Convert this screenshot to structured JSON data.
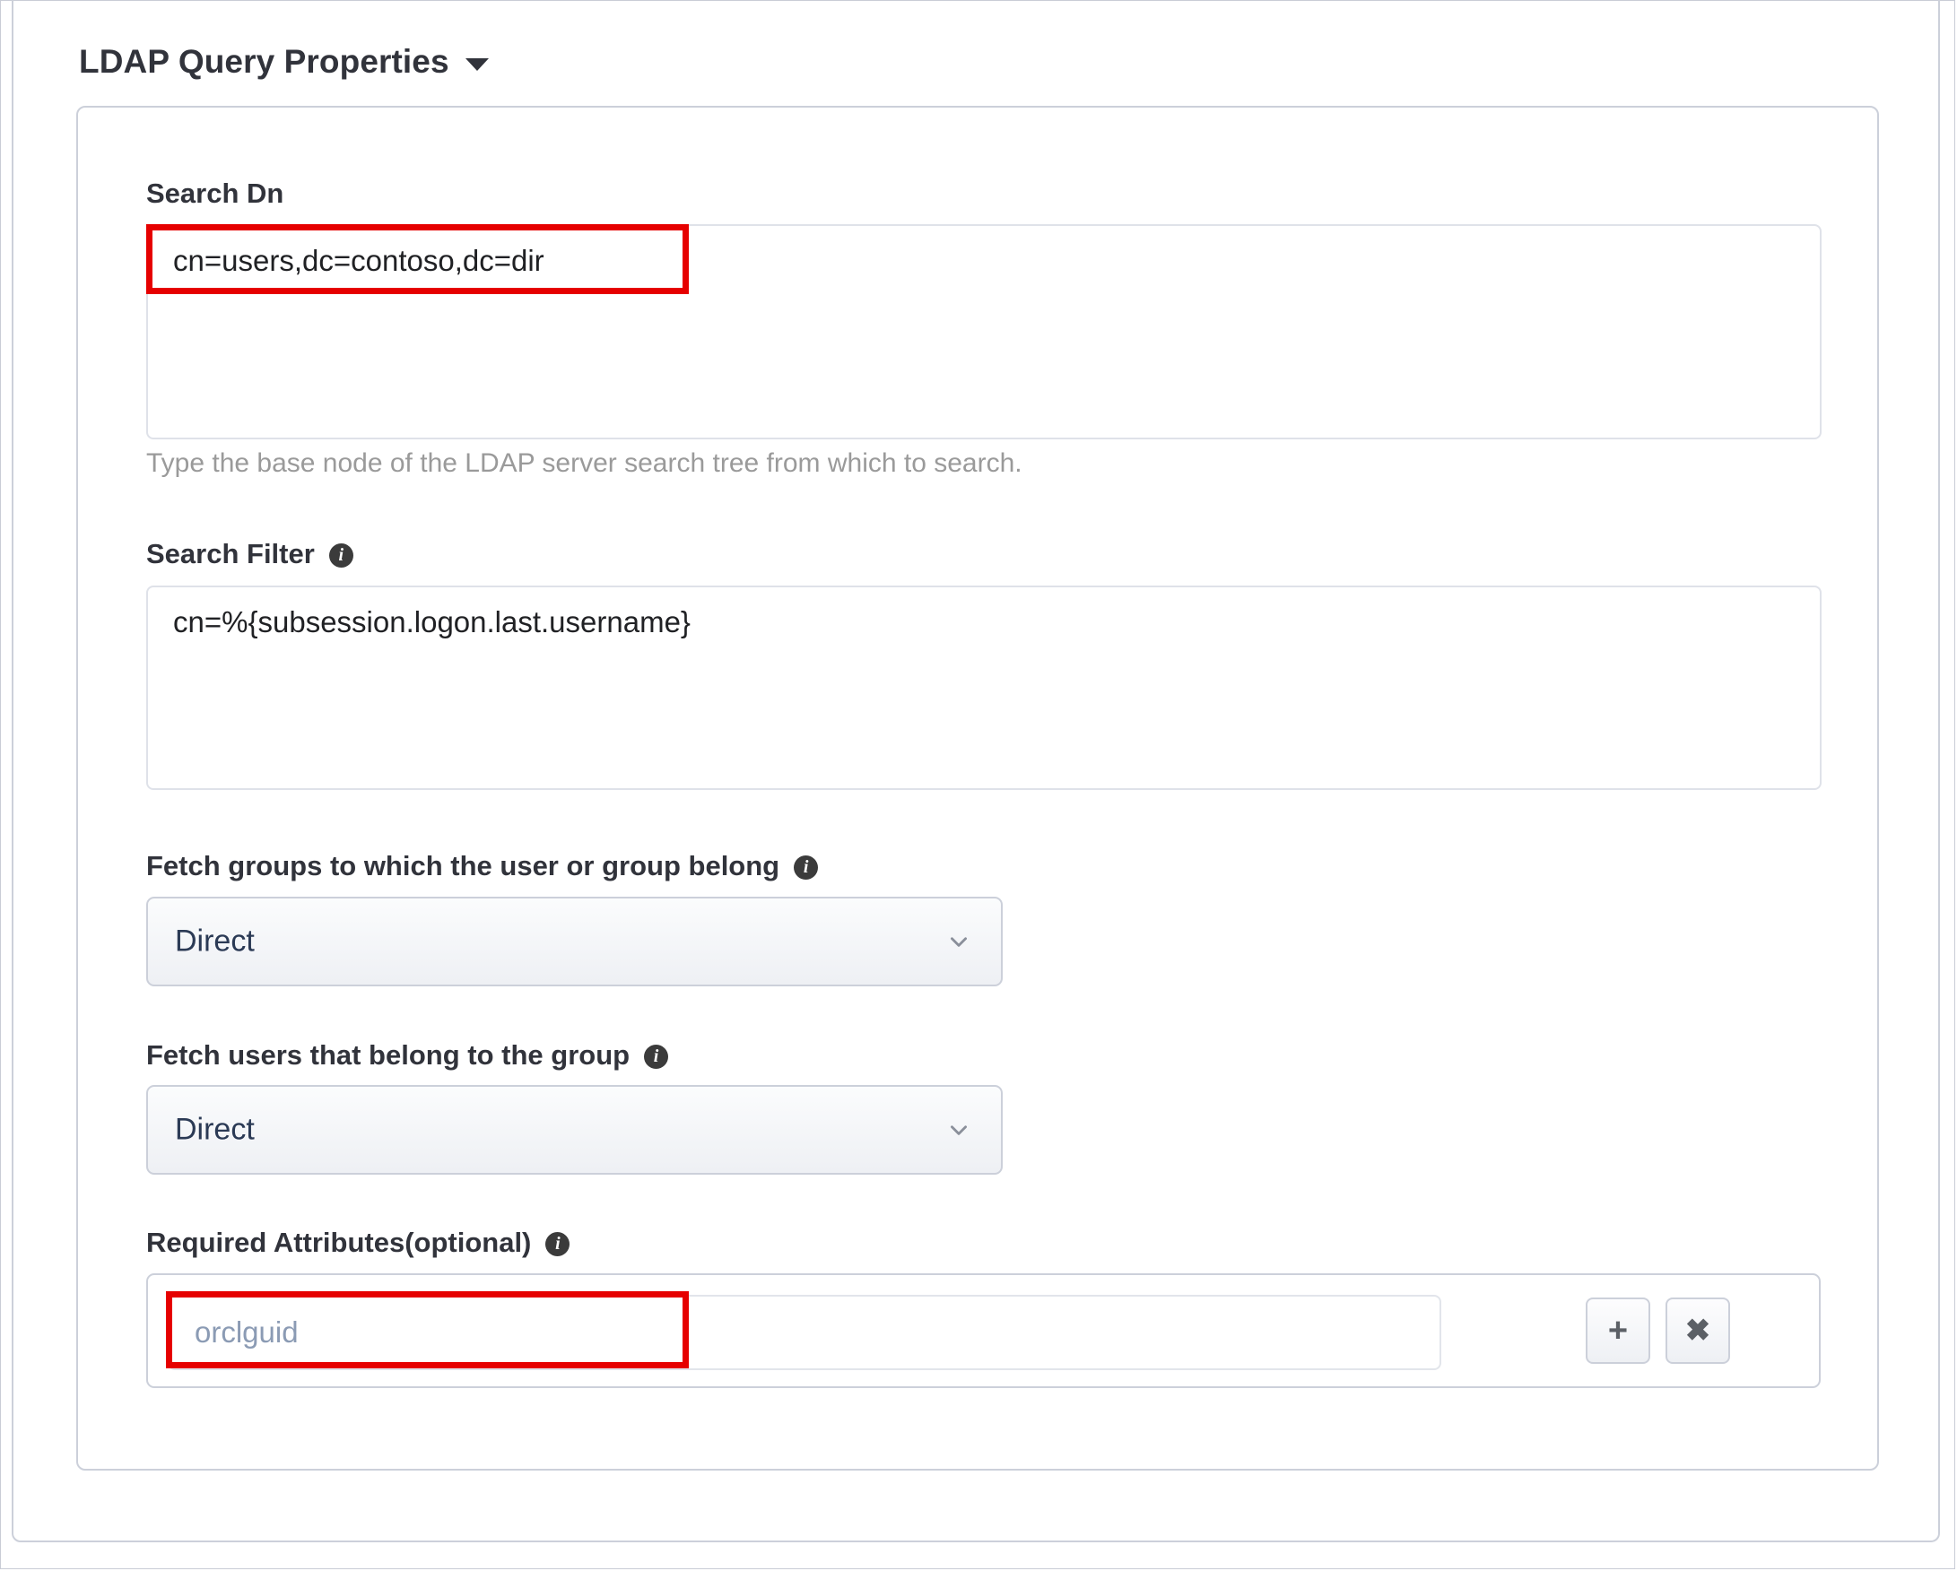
{
  "section": {
    "title": "LDAP Query Properties",
    "caret_icon": "caret-down-icon",
    "expanded": true
  },
  "fields": {
    "search_dn": {
      "label": "Search Dn",
      "value": "cn=users,dc=contoso,dc=dir",
      "help": "Type the base node of the LDAP server search tree from which to search.",
      "highlighted": true
    },
    "search_filter": {
      "label": "Search Filter",
      "info_icon": "info-icon",
      "value": "cn=%{subsession.logon.last.username}"
    },
    "fetch_groups": {
      "label": "Fetch groups to which the user or group belong",
      "info_icon": "info-icon",
      "selected": "Direct",
      "chevron_icon": "chevron-down-icon"
    },
    "fetch_users": {
      "label": "Fetch users that belong to the group",
      "info_icon": "info-icon",
      "selected": "Direct",
      "chevron_icon": "chevron-down-icon"
    },
    "required_attributes": {
      "label": "Required Attributes(optional)",
      "info_icon": "info-icon",
      "value": "orclguid",
      "highlighted": true,
      "add_button_label": "+",
      "add_button_icon": "plus-icon",
      "remove_button_label": "✖",
      "remove_button_icon": "close-icon"
    }
  },
  "colors": {
    "annotation": "#e60000",
    "label_text": "#31333b",
    "help_text": "#9a9a9a",
    "select_text": "#2b3a55",
    "placeholder_text": "#8b9bb4",
    "border": "#ccd0da"
  }
}
